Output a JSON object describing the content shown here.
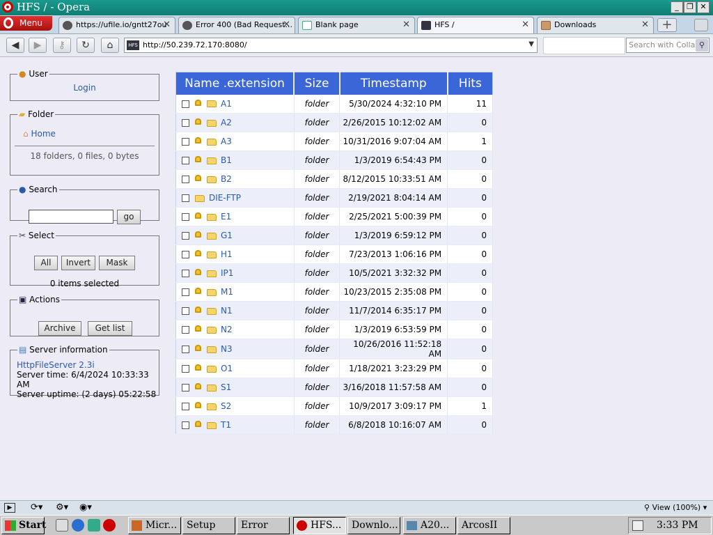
{
  "window": {
    "title": "HFS / - Opera"
  },
  "tabs": {
    "menu_label": "Menu",
    "items": [
      {
        "label": "https://ufile.io/gntt27ou"
      },
      {
        "label": "Error 400 (Bad Request..."
      },
      {
        "label": "Blank page"
      },
      {
        "label": "HFS /"
      },
      {
        "label": "Downloads"
      }
    ]
  },
  "nav": {
    "address": "http://50.239.72.170:8080/",
    "search_placeholder": "Search with Collab",
    "address_icon_text": "HFS"
  },
  "sidebar": {
    "user": {
      "legend": "User",
      "login": "Login"
    },
    "folder": {
      "legend": "Folder",
      "home": "Home",
      "summary": "18 folders, 0 files, 0 bytes"
    },
    "search": {
      "legend": "Search",
      "go": "go"
    },
    "select": {
      "legend": "Select",
      "all": "All",
      "invert": "Invert",
      "mask": "Mask",
      "status": "0 items selected"
    },
    "actions": {
      "legend": "Actions",
      "archive": "Archive",
      "get_list": "Get list"
    },
    "server": {
      "legend": "Server information",
      "software": "HttpFileServer 2.3i",
      "time": "Server time: 6/4/2024 10:33:33 AM",
      "uptime": "Server uptime: (2 days) 05:22:58"
    }
  },
  "table": {
    "headers": {
      "name": "Name .extension",
      "size": "Size",
      "timestamp": "Timestamp",
      "hits": "Hits"
    },
    "rows": [
      {
        "name": "A1",
        "size": "folder",
        "timestamp": "5/30/2024 4:32:10 PM",
        "hits": "11",
        "locked": true
      },
      {
        "name": "A2",
        "size": "folder",
        "timestamp": "2/26/2015 10:12:02 AM",
        "hits": "0",
        "locked": true
      },
      {
        "name": "A3",
        "size": "folder",
        "timestamp": "10/31/2016 9:07:04 AM",
        "hits": "1",
        "locked": true
      },
      {
        "name": "B1",
        "size": "folder",
        "timestamp": "1/3/2019 6:54:43 PM",
        "hits": "0",
        "locked": true
      },
      {
        "name": "B2",
        "size": "folder",
        "timestamp": "8/12/2015 10:33:51 AM",
        "hits": "0",
        "locked": true
      },
      {
        "name": "DIE-FTP",
        "size": "folder",
        "timestamp": "2/19/2021 8:04:14 AM",
        "hits": "0",
        "locked": false
      },
      {
        "name": "E1",
        "size": "folder",
        "timestamp": "2/25/2021 5:00:39 PM",
        "hits": "0",
        "locked": true
      },
      {
        "name": "G1",
        "size": "folder",
        "timestamp": "1/3/2019 6:59:12 PM",
        "hits": "0",
        "locked": true
      },
      {
        "name": "H1",
        "size": "folder",
        "timestamp": "7/23/2013 1:06:16 PM",
        "hits": "0",
        "locked": true
      },
      {
        "name": "IP1",
        "size": "folder",
        "timestamp": "10/5/2021 3:32:32 PM",
        "hits": "0",
        "locked": true
      },
      {
        "name": "M1",
        "size": "folder",
        "timestamp": "10/23/2015 2:35:08 PM",
        "hits": "0",
        "locked": true
      },
      {
        "name": "N1",
        "size": "folder",
        "timestamp": "11/7/2014 6:35:17 PM",
        "hits": "0",
        "locked": true
      },
      {
        "name": "N2",
        "size": "folder",
        "timestamp": "1/3/2019 6:53:59 PM",
        "hits": "0",
        "locked": true
      },
      {
        "name": "N3",
        "size": "folder",
        "timestamp": "10/26/2016 11:52:18 AM",
        "hits": "0",
        "locked": true
      },
      {
        "name": "O1",
        "size": "folder",
        "timestamp": "1/18/2021 3:23:29 PM",
        "hits": "0",
        "locked": true
      },
      {
        "name": "S1",
        "size": "folder",
        "timestamp": "3/16/2018 11:57:58 AM",
        "hits": "0",
        "locked": true
      },
      {
        "name": "S2",
        "size": "folder",
        "timestamp": "10/9/2017 3:09:17 PM",
        "hits": "1",
        "locked": true
      },
      {
        "name": "T1",
        "size": "folder",
        "timestamp": "6/8/2018 10:16:07 AM",
        "hits": "0",
        "locked": true
      }
    ]
  },
  "statusbar": {
    "zoom": "View (100%)"
  },
  "taskbar": {
    "start": "Start",
    "tasks": [
      {
        "label": "Micr..."
      },
      {
        "label": "Setup"
      },
      {
        "label": "Error"
      },
      {
        "label": "HFS..."
      },
      {
        "label": "Downlo..."
      },
      {
        "label": "A20..."
      },
      {
        "label": "ArcosII"
      }
    ],
    "clock": "3:33 PM"
  },
  "colors": {
    "table_header": "#3a66d8",
    "link": "#2b5aa8",
    "titlebar": "#1a9a8e"
  }
}
